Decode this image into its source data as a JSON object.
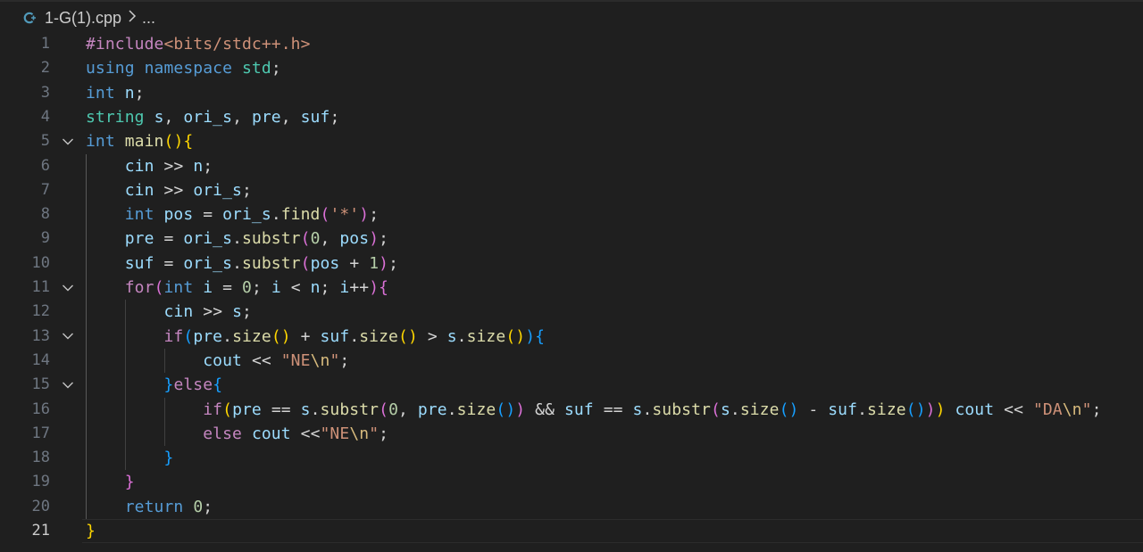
{
  "breadcrumb": {
    "file_icon": "cpp-file-icon",
    "file_name": "1-G(1).cpp",
    "separator_icon": "chevron-right-icon",
    "more": "..."
  },
  "editor": {
    "current_line": 21,
    "lines": [
      {
        "n": "1",
        "fold": false,
        "text": "#include<bits/stdc++.h>"
      },
      {
        "n": "2",
        "fold": false,
        "text": "using namespace std;"
      },
      {
        "n": "3",
        "fold": false,
        "text": "int n;"
      },
      {
        "n": "4",
        "fold": false,
        "text": "string s, ori_s, pre, suf;"
      },
      {
        "n": "5",
        "fold": true,
        "text": "int main(){"
      },
      {
        "n": "6",
        "fold": false,
        "text": "    cin >> n;"
      },
      {
        "n": "7",
        "fold": false,
        "text": "    cin >> ori_s;"
      },
      {
        "n": "8",
        "fold": false,
        "text": "    int pos = ori_s.find('*');"
      },
      {
        "n": "9",
        "fold": false,
        "text": "    pre = ori_s.substr(0, pos);"
      },
      {
        "n": "10",
        "fold": false,
        "text": "    suf = ori_s.substr(pos + 1);"
      },
      {
        "n": "11",
        "fold": true,
        "text": "    for(int i = 0; i < n; i++){"
      },
      {
        "n": "12",
        "fold": false,
        "text": "        cin >> s;"
      },
      {
        "n": "13",
        "fold": true,
        "text": "        if(pre.size() + suf.size() > s.size()){"
      },
      {
        "n": "14",
        "fold": false,
        "text": "            cout << \"NE\\n\";"
      },
      {
        "n": "15",
        "fold": true,
        "text": "        }else{"
      },
      {
        "n": "16",
        "fold": false,
        "text": "            if(pre == s.substr(0, pre.size()) && suf == s.substr(s.size() - suf.size())) cout << \"DA\\n\";"
      },
      {
        "n": "17",
        "fold": false,
        "text": "            else cout <<\"NE\\n\";"
      },
      {
        "n": "18",
        "fold": false,
        "text": "        }"
      },
      {
        "n": "19",
        "fold": false,
        "text": "    }"
      },
      {
        "n": "20",
        "fold": false,
        "text": "    return 0;"
      },
      {
        "n": "21",
        "fold": false,
        "text": "}"
      }
    ]
  },
  "colors": {
    "background": "#1f1f1f",
    "keyword": "#569cd6",
    "control": "#c586c0",
    "function": "#dcdcaa",
    "type": "#4ec9b0",
    "variable": "#9cdcfe",
    "string": "#ce9178",
    "escape": "#d7ba7d",
    "number": "#b5cea8",
    "bracket_level_1": "#ffd700",
    "bracket_level_2": "#da70d6",
    "bracket_level_3": "#179fff",
    "line_number": "#6e7681",
    "line_number_active": "#cccccc"
  }
}
